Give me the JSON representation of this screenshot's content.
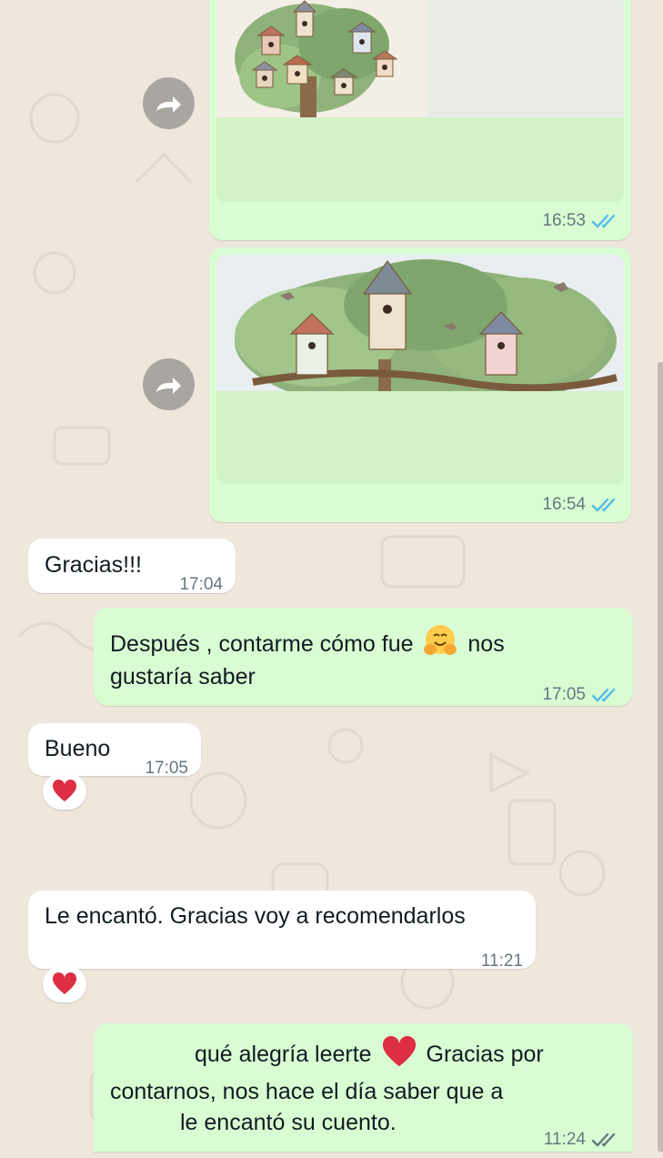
{
  "messages": [
    {
      "id": "m1",
      "kind": "image",
      "direction": "out",
      "time": "16:53",
      "status": "read",
      "thumbnail": "birdhouse-tree"
    },
    {
      "id": "m2",
      "kind": "image",
      "direction": "out",
      "time": "16:54",
      "status": "read",
      "thumbnail": "birdhouse-tree"
    },
    {
      "id": "m3",
      "kind": "text",
      "direction": "in",
      "text": "Gracias!!!",
      "time": "17:04"
    },
    {
      "id": "m4",
      "kind": "text",
      "direction": "out",
      "text_before_emoji": "Después , contarme cómo fue",
      "emoji": "hugging-face",
      "text_after_emoji": "nos",
      "text_line2": "gustaría saber",
      "time": "17:05",
      "status": "read"
    },
    {
      "id": "m5",
      "kind": "text",
      "direction": "in",
      "text": "Bueno",
      "time": "17:05",
      "reaction": "red-heart"
    },
    {
      "id": "m6",
      "kind": "text",
      "direction": "in",
      "text": "Le encantó. Gracias voy a recomendarlos",
      "time": "11:21",
      "reaction": "red-heart"
    },
    {
      "id": "m7",
      "kind": "text",
      "direction": "out",
      "line1_before_emoji": "qué alegría leerte",
      "emoji": "red-heart",
      "line1_after_emoji": "Gracias por",
      "line2": "contarnos, nos hace el día saber que a",
      "line3": "le encantó su cuento.",
      "time": "11:24",
      "status": "delivered"
    }
  ],
  "colors": {
    "outgoing_bubble": "#d9fdd3",
    "incoming_bubble": "#ffffff",
    "wallpaper": "#efe7dc",
    "read_ticks": "#53bdeb",
    "delivered_ticks": "#667781"
  },
  "icons": {
    "forward": "forward-icon",
    "read": "double-check-icon",
    "reaction": "red-heart"
  }
}
